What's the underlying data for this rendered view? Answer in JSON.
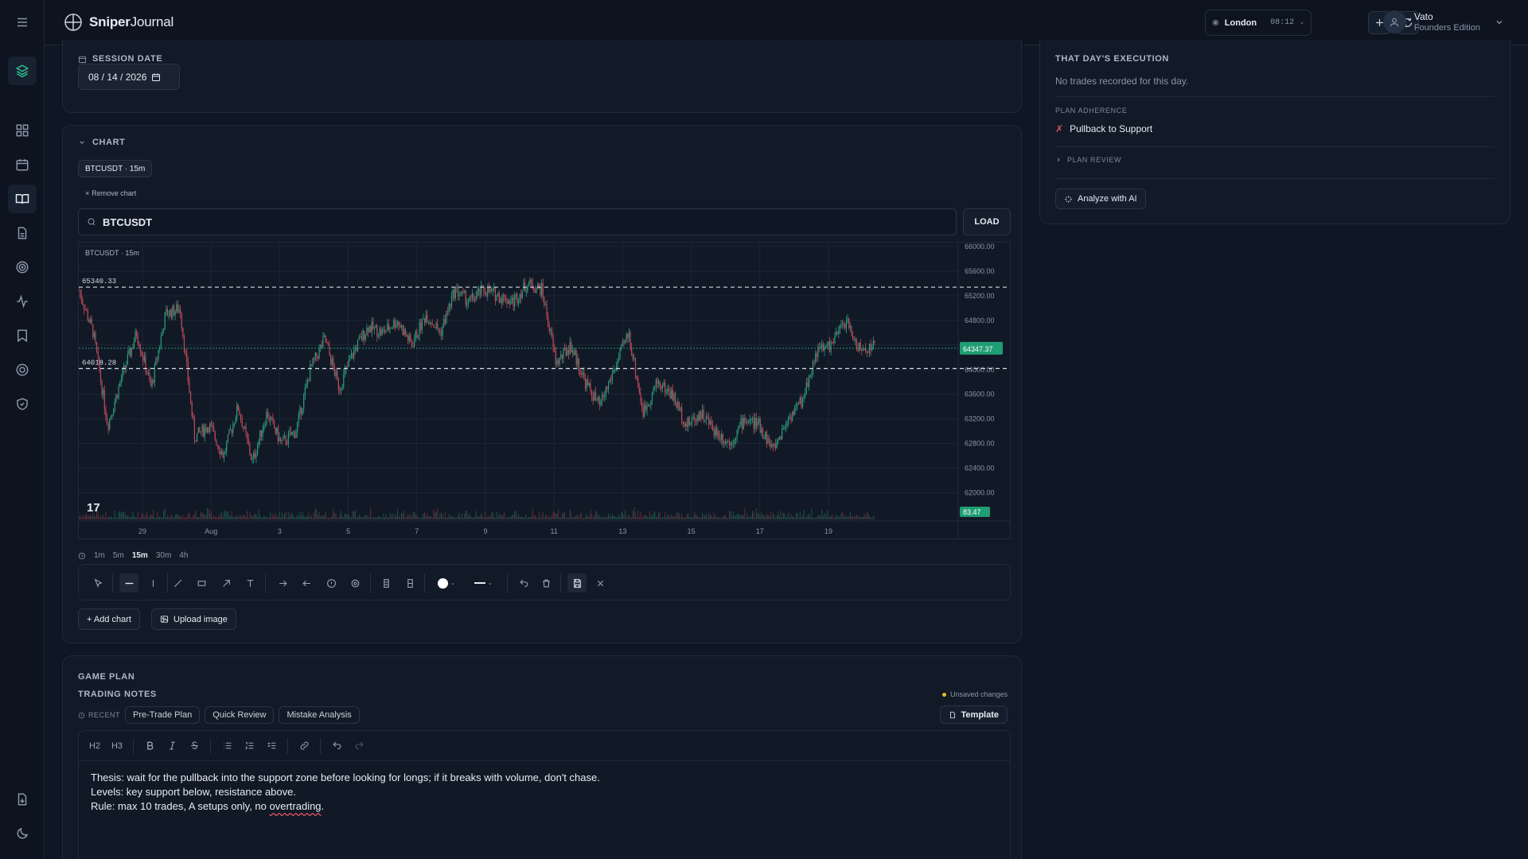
{
  "app": {
    "brand_bold": "Sniper",
    "brand_rest": "Journal"
  },
  "header": {
    "session_location": "London",
    "session_time": "08:12",
    "user_name": "Vato",
    "user_role": "Founders Edition"
  },
  "sidebar": {
    "items": [
      "menu-icon",
      "layers-icon",
      "dashboard-icon",
      "calendar-icon",
      "journal-icon",
      "file-icon",
      "target-icon",
      "activity-icon",
      "bookmark-icon",
      "help-icon",
      "shield-icon",
      "export-icon",
      "moon-icon"
    ],
    "active": "journal-icon"
  },
  "session_date": {
    "label": "SESSION DATE",
    "value": "08 / 14 / 2026"
  },
  "chart_section": {
    "label": "CHART",
    "chip": "BTCUSDT · 15m",
    "remove_label": "Remove chart",
    "search_value": "BTCUSDT",
    "load_label": "LOAD",
    "timeframes": [
      "1m",
      "5m",
      "15m",
      "30m",
      "4h"
    ],
    "active_timeframe": "15m",
    "add_chart_label": "+ Add chart",
    "upload_label": "Upload image"
  },
  "chart_data": {
    "type": "candlestick",
    "title": "BTCUSDT · 15m",
    "y_ticks": [
      "66000.00",
      "65600.00",
      "65200.00",
      "64800.00",
      "64400.00",
      "64000.00",
      "63600.00",
      "63200.00",
      "62800.00",
      "62400.00",
      "62000.00"
    ],
    "ylim": [
      61800,
      66000
    ],
    "x_ticks": [
      "29",
      "Aug",
      "3",
      "5",
      "7",
      "9",
      "11",
      "13",
      "15",
      "17",
      "19"
    ],
    "levels": [
      "65340.33",
      "64018.28"
    ],
    "last_price": "64347.37",
    "volume_label": "83.47",
    "price_path": [
      65300,
      64600,
      63100,
      63900,
      64600,
      63700,
      64900,
      65000,
      62900,
      63100,
      62600,
      63400,
      62500,
      63300,
      62800,
      63000,
      64000,
      64500,
      63700,
      64300,
      64700,
      64600,
      64800,
      64400,
      64900,
      64600,
      65300,
      65100,
      65300,
      65200,
      65100,
      65400,
      65300,
      64100,
      64400,
      63800,
      63400,
      64000,
      64600,
      63300,
      63800,
      63600,
      63100,
      63300,
      63000,
      62800,
      63200,
      63100,
      62700,
      63200,
      63500,
      64300,
      64400,
      64800,
      64300,
      64400
    ]
  },
  "execution": {
    "label": "THAT DAY'S EXECUTION",
    "empty_text": "No trades recorded for this day.",
    "adherence_label": "PLAN ADHERENCE",
    "adherence_item": "Pullback to Support",
    "review_label": "PLAN REVIEW",
    "analyze_label": "Analyze with AI"
  },
  "game_plan": {
    "label": "GAME PLAN",
    "notes_label": "TRADING NOTES",
    "status": "Unsaved changes",
    "recent_label": "RECENT",
    "recent": [
      "Pre-Trade Plan",
      "Quick Review",
      "Mistake Analysis"
    ],
    "template_label": "Template",
    "toolbar": [
      "H2",
      "H3"
    ],
    "line1": "Thesis: wait for the pullback into the support zone before looking for longs; if it breaks with volume, don't chase.",
    "line2": "Levels: key support below, resistance above.",
    "line3_a": "Rule: max 10 trades, A setups only, no ",
    "line3_b": "overtrading",
    "line3_c": "."
  },
  "colors": {
    "accent": "#2fbf8f",
    "bg": "#0f1624",
    "card": "#121a27",
    "up": "#2a9d7f",
    "down": "#c24a59",
    "status": "#e8b923"
  }
}
